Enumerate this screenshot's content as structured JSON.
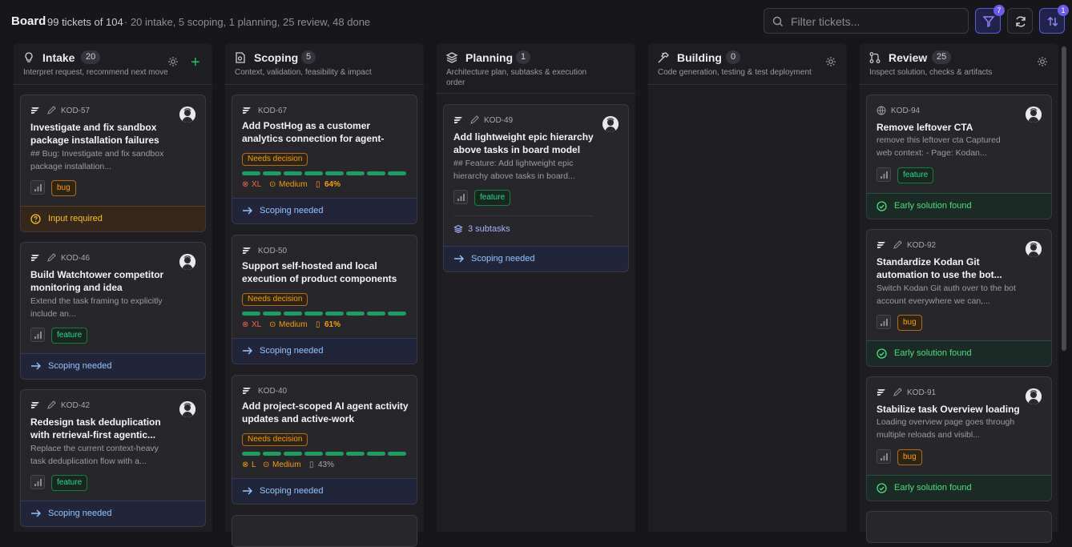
{
  "header": {
    "title": "Board",
    "count": "99 tickets of 104",
    "breakdown": "· 20 intake, 5 scoping, 1 planning, 25 review, 48 done",
    "search_placeholder": "Filter tickets...",
    "filter_badge": "7",
    "sort_badge": "1"
  },
  "colors": {
    "accent": "#6d5ce8",
    "green": "#22c55e",
    "amber": "#f59e0b",
    "blue": "#93c5fd"
  },
  "columns": [
    {
      "title": "Intake",
      "count": "20",
      "subtitle": "Interpret request, recommend next move",
      "icon": "lightbulb-icon"
    },
    {
      "title": "Scoping",
      "count": "5",
      "subtitle": "Context, validation, feasibility & impact",
      "icon": "document-icon"
    },
    {
      "title": "Planning",
      "count": "1",
      "subtitle": "Architecture plan, subtasks & execution order",
      "icon": "layers-icon"
    },
    {
      "title": "Building",
      "count": "0",
      "subtitle": "Code generation, testing & test deployment",
      "icon": "hammer-icon"
    },
    {
      "title": "Review",
      "count": "25",
      "subtitle": "Inspect solution, checks & artifacts",
      "icon": "git-pull-request-icon"
    }
  ],
  "cards": {
    "intake": [
      {
        "id": "KOD-57",
        "title": "Investigate and fix sandbox package installation failures an...",
        "desc": "## Bug: Investigate and fix sandbox package installation...",
        "tag": "bug",
        "footer": "Input required"
      },
      {
        "id": "KOD-46",
        "title": "Build Watchtower competitor monitoring and idea generation...",
        "desc": "Extend the task framing to explicitly include an...",
        "tag": "feature",
        "footer": "Scoping needed"
      },
      {
        "id": "KOD-42",
        "title": "Redesign task deduplication with retrieval-first agentic...",
        "desc": "Replace the current context-heavy task deduplication flow with a...",
        "tag": "feature",
        "footer": "Scoping needed"
      }
    ],
    "scoping": [
      {
        "id": "KOD-67",
        "title": "Add PostHog as a customer analytics connection for agent-assisted...",
        "decision": "Needs decision",
        "progress": 0.64,
        "size": "XL",
        "priority": "Medium",
        "confidence": "64%",
        "footer": "Scoping needed"
      },
      {
        "id": "KOD-50",
        "title": "Support self-hosted and local execution of product components",
        "decision": "Needs decision",
        "progress": 0.61,
        "size": "XL",
        "priority": "Medium",
        "confidence": "61%",
        "footer": "Scoping needed"
      },
      {
        "id": "KOD-40",
        "title": "Add project-scoped AI agent activity updates and active-work indicators...",
        "decision": "Needs decision",
        "progress": 0.43,
        "size": "L",
        "priority": "Medium",
        "confidence": "43%",
        "footer": "Scoping needed"
      }
    ],
    "planning": [
      {
        "id": "KOD-49",
        "title": "Add lightweight epic hierarchy above tasks in board model",
        "desc": "## Feature: Add lightweight epic hierarchy above tasks in board...",
        "tag": "feature",
        "subtasks": "3 subtasks",
        "footer": "Scoping needed"
      }
    ],
    "review": [
      {
        "id": "KOD-94",
        "title": "Remove leftover CTA",
        "desc": "remove this leftover cta Captured web context: - Page: Kodan...",
        "tag": "feature",
        "footer": "Early solution found"
      },
      {
        "id": "KOD-92",
        "title": "Standardize Kodan Git automation to use the bot...",
        "desc": "Switch Kodan Git auth over to the bot account everywhere we can,...",
        "tag": "bug",
        "footer": "Early solution found"
      },
      {
        "id": "KOD-91",
        "title": "Stabilize task Overview loading",
        "desc": "Loading overview page goes through multiple reloads and visibl...",
        "tag": "bug",
        "footer": "Early solution found"
      }
    ]
  }
}
